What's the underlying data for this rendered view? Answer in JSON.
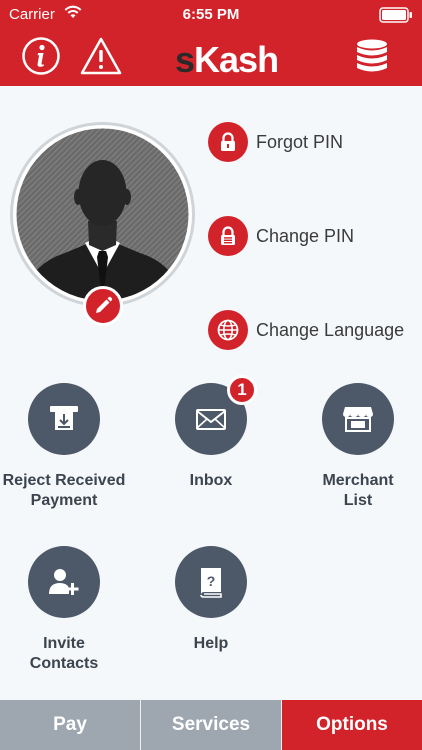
{
  "status_bar": {
    "carrier": "Carrier",
    "time": "6:55 PM"
  },
  "header": {
    "logo_s": "s",
    "logo_k": "K",
    "logo_rest": "ash",
    "left_icons": [
      "info-icon",
      "warning-icon"
    ],
    "right_icon": "coins-icon"
  },
  "profile": {
    "avatar": "user-silhouette",
    "edit_icon": "pencil-icon"
  },
  "side_actions": [
    {
      "label": "Forgot PIN",
      "icon": "lock-icon"
    },
    {
      "label": "Change PIN",
      "icon": "lock-change-icon"
    },
    {
      "label": "Change Language",
      "icon": "globe-icon"
    }
  ],
  "tiles": [
    {
      "label_line1": "Reject Received",
      "label_line2": "Payment",
      "icon": "atm-reject-icon"
    },
    {
      "label_line1": "Inbox",
      "label_line2": "",
      "icon": "envelope-icon",
      "badge": "1"
    },
    {
      "label_line1": "Merchant",
      "label_line2": "List",
      "icon": "store-icon"
    },
    {
      "label_line1": "Invite",
      "label_line2": "Contacts",
      "icon": "add-user-icon"
    },
    {
      "label_line1": "Help",
      "label_line2": "",
      "icon": "help-book-icon"
    }
  ],
  "tabs": [
    {
      "label": "Pay",
      "active": false
    },
    {
      "label": "Services",
      "active": false
    },
    {
      "label": "Options",
      "active": true
    }
  ],
  "colors": {
    "brand_red": "#d2232a",
    "tile_gray": "#4d5868",
    "tab_gray": "#9ea7b0"
  }
}
